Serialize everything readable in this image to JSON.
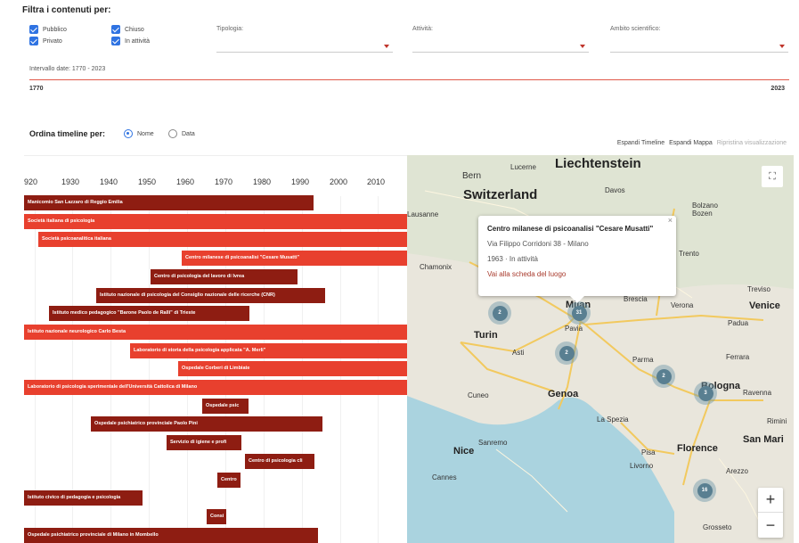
{
  "filters": {
    "title": "Filtra i contenuti per:",
    "checkboxes": [
      {
        "label": "Pubblico",
        "checked": true
      },
      {
        "label": "Chiuso",
        "checked": true
      },
      {
        "label": "Privato",
        "checked": true
      },
      {
        "label": "In attività",
        "checked": true
      }
    ],
    "selects": [
      {
        "label": "Tipologia:",
        "value": ""
      },
      {
        "label": "Attività:",
        "value": ""
      },
      {
        "label": "Ambito scientifico:",
        "value": ""
      }
    ],
    "date_range_label": "Intervallo date: 1770 - 2023",
    "date_min": "1770",
    "date_max": "2023"
  },
  "sort": {
    "title": "Ordina timeline per:",
    "options": [
      {
        "label": "Nome",
        "selected": true
      },
      {
        "label": "Data",
        "selected": false
      }
    ]
  },
  "controls": {
    "expand_timeline": "Espandi Timeline",
    "expand_map": "Espandi Mappa",
    "reset": "Ripristina visualizzazione"
  },
  "timeline": {
    "ticks": [
      "920",
      "1930",
      "1940",
      "1950",
      "1960",
      "1970",
      "1980",
      "1990",
      "2000",
      "2010"
    ],
    "bars": [
      {
        "label": "Manicomio San Lazzaro di Reggio Emilia",
        "color": "#8e1d12"
      },
      {
        "label": "Società italiana di psicologia",
        "color": "#e8402e"
      },
      {
        "label": "Società psicoanalitica italiana",
        "color": "#e8402e"
      },
      {
        "label": "Centro milanese di psicoanalisi \"Cesare Musatti\"",
        "color": "#e8402e"
      },
      {
        "label": "Centro di psicologia del lavoro di Ivrea",
        "color": "#8e1d12"
      },
      {
        "label": "Istituto nazionale di psicologia del Consiglio nazionale delle ricerche (CNR)",
        "color": "#8e1d12"
      },
      {
        "label": "Istituto medico pedagogico \"Barone Paolo de Ralli\" di Trieste",
        "color": "#8e1d12"
      },
      {
        "label": "Istituto nazionale neurologico Carlo Besta",
        "color": "#e8402e"
      },
      {
        "label": "Laboratorio di storia della psicologia applicata \"A. Merli\"",
        "color": "#e8402e"
      },
      {
        "label": "Ospedale Corberi di Limbiate",
        "color": "#e8402e"
      },
      {
        "label": "Laboratorio di psicologia sperimentale dell'Università Cattolica di Milano",
        "color": "#e8402e"
      },
      {
        "label": "Ospedale psic",
        "color": "#8e1d12"
      },
      {
        "label": "Ospedale psichiatrico provinciale Paolo Pini",
        "color": "#8e1d12"
      },
      {
        "label": "Servizio di igiene e profi",
        "color": "#8e1d12"
      },
      {
        "label": "Centro di psicologia cli",
        "color": "#8e1d12"
      },
      {
        "label": "Centro",
        "color": "#8e1d12"
      },
      {
        "label": "Istituto civico di pedagogia e psicologia",
        "color": "#8e1d12"
      },
      {
        "label": "Consi",
        "color": "#8e1d12"
      },
      {
        "label": "Ospedale psichiatrico provinciale di Milano in Mombello",
        "color": "#8e1d12"
      }
    ]
  },
  "map": {
    "places": [
      "Liechtenstein",
      "Switzerland",
      "Bern",
      "Lucerne",
      "Davos",
      "Bolzano Bozen",
      "Trento",
      "Lausanne",
      "Chamonix",
      "Brescia",
      "Verona",
      "Treviso",
      "Venice",
      "Padua",
      "Turin",
      "Asti",
      "Pavia",
      "Parma",
      "Ferrara",
      "Bologna",
      "Ravenna",
      "Rimini",
      "San Mari",
      "Genoa",
      "Cuneo",
      "La Spezia",
      "Nice",
      "Sanremo",
      "Cannes",
      "Pisa",
      "Livorno",
      "Florence",
      "Arezzo",
      "Grosseto",
      "Milan"
    ],
    "clusters": [
      "2",
      "31",
      "2",
      "2",
      "3",
      "16"
    ],
    "popup": {
      "title": "Centro milanese di psicoanalisi \"Cesare Musatti\"",
      "address": "Via Filippo Corridoni 38 - Milano",
      "meta": "1963 · In attività",
      "link": "Vai alla scheda del luogo",
      "close": "×"
    },
    "zoom_in": "+",
    "zoom_out": "−",
    "fullscreen_icon": "⛶"
  }
}
